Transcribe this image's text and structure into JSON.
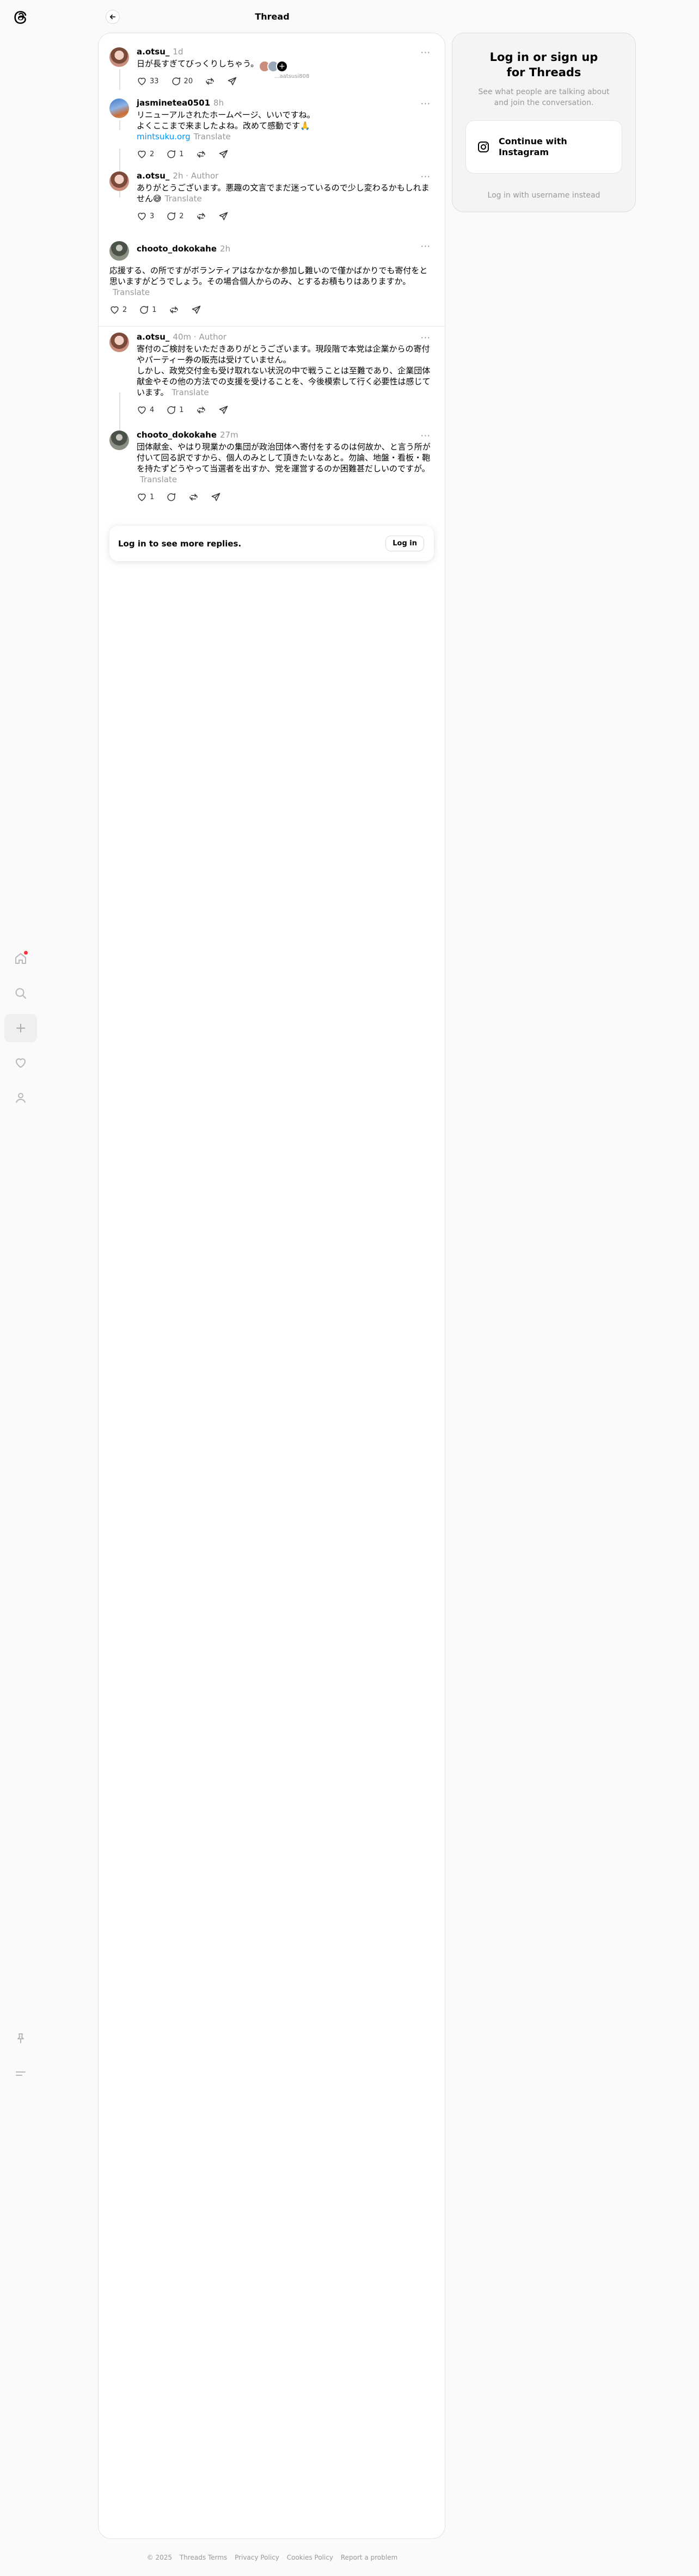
{
  "header": {
    "title": "Thread"
  },
  "nav": {
    "icons": [
      "home-icon",
      "search-icon",
      "create-icon",
      "activity-icon",
      "profile-icon"
    ],
    "bottom_icons": [
      "pin-icon",
      "menu-icon"
    ]
  },
  "posts": [
    {
      "username": "a.otsu_",
      "time": "1d",
      "text": "日が長すぎてびっくりしちゃう。",
      "likes": "33",
      "replies": "20",
      "liked_by_label": "...aatsusi808"
    },
    {
      "username": "jasminetea0501",
      "time": "8h",
      "text_line1": "リニューアルされたホームページ、いいですね。",
      "text_line2": "よくここまで来ましたよね。改めて感動です🙏",
      "link": "mintsuku.org",
      "translate": "Translate",
      "likes": "2",
      "replies": "1"
    },
    {
      "username": "a.otsu_",
      "time": "2h",
      "author": "Author",
      "text": "ありがとうございます。悪趣の文言でまだ迷っているので少し変わるかもしれません😅",
      "translate": "Translate",
      "likes": "3",
      "replies": "2"
    },
    {
      "username": "chooto_dokokahe",
      "time": "2h",
      "text": "応援する、の所ですがボランティアはなかなか参加し難いので僅かばかりでも寄付をと思いますがどうでしょう。その場合個人からのみ、とするお積もりはありますか。",
      "translate": "Translate",
      "likes": "2",
      "replies": "1"
    },
    {
      "username": "a.otsu_",
      "time": "40m",
      "author": "Author",
      "text_p1": "寄付のご検討をいただきありがとうございます。現段階で本党は企業からの寄付やパーティー券の販売は受けていません。",
      "text_p2": "しかし、政党交付金も受け取れない状況の中で戦うことは至難であり、企業団体献金やその他の方法での支援を受けることを、今後模索して行く必要性は感じています。",
      "translate": "Translate",
      "likes": "4",
      "replies": "1"
    },
    {
      "username": "chooto_dokokahe",
      "time": "27m",
      "text": "団体献金、やはり現業かの集団が政治団体へ寄付をするのは何故か、と言う所が付いて回る訳ですから、個人のみとして頂きたいなあと。勿論、地盤・看板・鞄を持たずどうやって当選者を出すか、党を運営するのか困難甚だしいのですが。",
      "translate": "Translate",
      "likes": "1"
    }
  ],
  "login_more": {
    "text": "Log in to see more replies.",
    "button": "Log in"
  },
  "sidebar_card": {
    "title": "Log in or sign up for Threads",
    "subtitle": "See what people are talking about and join the conversation.",
    "instagram_button": "Continue with Instagram",
    "alt_login": "Log in with username instead"
  },
  "footer": {
    "copyright": "© 2025",
    "links": [
      "Threads Terms",
      "Privacy Policy",
      "Cookies Policy",
      "Report a problem"
    ]
  },
  "colors": {
    "accent_link": "#0095f6",
    "notification_dot": "#ff3040",
    "muted": "#999999"
  }
}
